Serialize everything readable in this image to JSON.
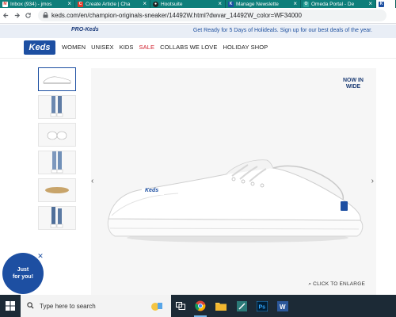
{
  "browser": {
    "tabs": [
      {
        "label": "Inbox (934) - jmos",
        "icon": "gmail-icon",
        "color": "#d93025",
        "active": false
      },
      {
        "label": "Create Article | Cha",
        "icon": "cms-icon",
        "color": "#e03b2c",
        "active": false
      },
      {
        "label": "Hootsuite",
        "icon": "hootsuite-icon",
        "color": "#222222",
        "active": false
      },
      {
        "label": "Manage Newslette",
        "icon": "keds-favicon-icon",
        "color": "#1d4fa2",
        "active": false
      },
      {
        "label": "Omeda Portal - De",
        "icon": "omeda-icon",
        "color": "#2aa198",
        "active": false
      },
      {
        "label": "",
        "icon": "keds-favicon-icon",
        "color": "#1d4fa2",
        "active": true
      }
    ],
    "url": "keds.com/en/champion-originals-sneaker/14492W.html?dwvar_14492W_color=WF34000"
  },
  "promo": {
    "pro_label": "PRO-Keds",
    "message": "Get Ready for 5 Days of Holideals. Sign up for our best deals of the year."
  },
  "site": {
    "logo": "Keds",
    "nav": [
      "WOMEN",
      "UNISEX",
      "KIDS",
      "SALE",
      "COLLABS WE LOVE",
      "HOLIDAY SHOP"
    ]
  },
  "product": {
    "badge_line1": "NOW IN",
    "badge_line2": "WIDE",
    "enlarge_label": "CLICK TO ENLARGE",
    "shoe_brand": "Keds",
    "thumbnails": [
      "thumb-shoe-side",
      "thumb-legs-front",
      "thumb-shoe-pair",
      "thumb-legs-standing",
      "thumb-sole",
      "thumb-legs-walking"
    ]
  },
  "popup": {
    "line1": "Just",
    "line2": "for you!"
  },
  "taskbar": {
    "search_placeholder": "Type here to search",
    "apps": [
      "chrome-icon",
      "file-explorer-icon",
      "sticky-notes-icon",
      "photoshop-icon",
      "word-icon"
    ]
  },
  "colors": {
    "brand_blue": "#1d4fa2",
    "tab_teal": "#0f7f7b",
    "sale_red": "#d0202e"
  }
}
